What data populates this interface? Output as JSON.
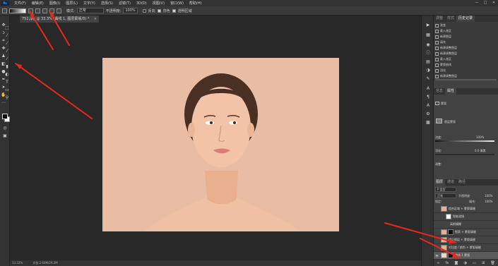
{
  "app": {
    "logo": "Ps"
  },
  "menu": [
    "文件(F)",
    "编辑(E)",
    "图像(I)",
    "图层(L)",
    "文字(Y)",
    "选择(S)",
    "滤镜(T)",
    "3D(D)",
    "视图(V)",
    "窗口(W)",
    "帮助(H)"
  ],
  "window_controls": {
    "minimize": "—",
    "maximize": "□",
    "close": "✕"
  },
  "options": {
    "mode_label": "模式:",
    "mode_value": "正常",
    "opacity_label": "不透明度:",
    "opacity_value": "100%",
    "reverse_label": "反向",
    "dither_label": "仿色",
    "transparency_label": "透明区域"
  },
  "document": {
    "tab_title": "752.jpg @ 33.3% (曲线 1, 图层蒙版/8) *",
    "tab_close": "×",
    "status_zoom": "33.33%",
    "status_doc": "文档:2.64M/29.2M"
  },
  "history": {
    "tabs": [
      "调整",
      "样式",
      "历史记录"
    ],
    "items": [
      "渐变",
      "载入选区",
      "新建图层",
      "填充",
      "新建调整图层",
      "新建调整图层",
      "载入选区",
      "蒙版曲线",
      "羽化",
      "新建调整图层",
      "渐变"
    ]
  },
  "properties": {
    "tabs": [
      "信息",
      "属性"
    ],
    "type_label": "蒙版",
    "mask_label": "图层蒙版",
    "density_label": "浓度:",
    "density_value": "100%",
    "feather_label": "羽化:",
    "feather_value": "0.0 像素",
    "adjust_label": "调整:"
  },
  "layers": {
    "tabs": [
      "图层",
      "通道",
      "路径"
    ],
    "kind_value": "P 类型",
    "blend_value": "正常",
    "opacity_label": "不透明度:",
    "opacity_value": "100%",
    "lock_label": "锁定:",
    "fill_label": "填充:",
    "fill_value": "100%",
    "rows": [
      {
        "name": "组合区域 + 蒙版填缝",
        "eye": "",
        "mask": false,
        "selected": false
      },
      {
        "name": "智能滤镜",
        "eye": "",
        "mask": true,
        "selected": false
      },
      {
        "name": "高斯模糊",
        "eye": "",
        "mask": false,
        "selected": false
      },
      {
        "name": "图案 + 蒙版填缝",
        "eye": "",
        "mask": true,
        "selected": false
      },
      {
        "name": "拷贝图层 + 蒙版填缝",
        "eye": "",
        "mask": false,
        "selected": false
      },
      {
        "name": "对比度 / 颜色 + 蒙版填缝",
        "eye": "",
        "mask": false,
        "selected": false
      },
      {
        "name": "曲线 1 蒙版",
        "eye": "👁",
        "mask": true,
        "selected": true
      },
      {
        "name": "背景",
        "eye": "👁",
        "mask": false,
        "selected": false
      }
    ]
  },
  "colors": {
    "accent": "#31a8ff",
    "photo_bg": "#e9bda3",
    "arrow": "#e8281c",
    "skin": "#f2c3a6",
    "hair": "#4a2f24",
    "lips": "#e07a78"
  },
  "icons": {
    "tools": [
      "move-icon",
      "marquee-icon",
      "lasso-icon",
      "magic-wand-icon",
      "crop-icon",
      "eyedropper-icon",
      "healing-icon",
      "brush-icon",
      "stamp-icon",
      "history-brush-icon",
      "eraser-icon",
      "gradient-icon",
      "blur-icon",
      "dodge-icon",
      "pen-icon",
      "type-icon",
      "path-select-icon",
      "shape-icon",
      "hand-icon",
      "zoom-icon"
    ]
  }
}
